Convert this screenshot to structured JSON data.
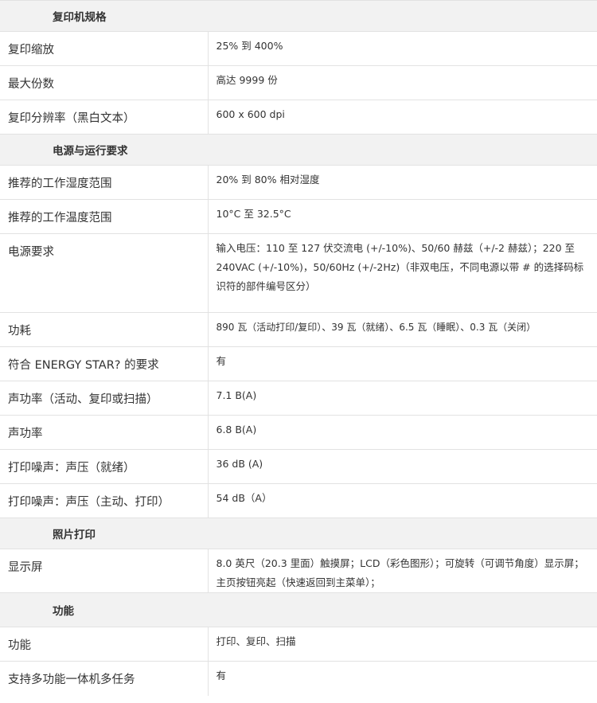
{
  "sections": [
    {
      "title": "复印机规格",
      "rows": [
        {
          "label": "复印缩放",
          "value": "25% 到 400%"
        },
        {
          "label": "最大份数",
          "value": "高达 9999 份"
        },
        {
          "label": "复印分辨率（黑白文本）",
          "value": "600 x 600 dpi"
        }
      ]
    },
    {
      "title": "电源与运行要求",
      "rows": [
        {
          "label": "推荐的工作湿度范围",
          "value": "20% 到 80% 相对湿度"
        },
        {
          "label": "推荐的工作温度范围",
          "value": "10°C 至 32.5°C"
        },
        {
          "label": "电源要求",
          "value": "输入电压：110 至 127 伏交流电 (+/-10%)、50/60 赫兹（+/-2 赫兹）；220 至 240VAC (+/-10%)，50/60Hz (+/-2Hz)（非双电压，不同电源以带 # 的选择码标识符的部件编号区分）"
        },
        {
          "label": "功耗",
          "value": "890 瓦（活动打印/复印）、39 瓦（就绪）、6.5 瓦（睡眠）、0.3 瓦（关闭）"
        },
        {
          "label": "符合 ENERGY STAR? 的要求",
          "value": "有"
        },
        {
          "label": "声功率（活动、复印或扫描）",
          "value": "7.1 B(A)"
        },
        {
          "label": "声功率",
          "value": "6.8 B(A)"
        },
        {
          "label": "打印噪声：声压（就绪）",
          "value": "36 dB (A)"
        },
        {
          "label": "打印噪声：声压（主动、打印）",
          "value": "54 dB（A）"
        }
      ]
    },
    {
      "title": "照片打印",
      "rows": [
        {
          "label": "显示屏",
          "value": "8.0 英尺（20.3 里面）触摸屏；LCD（彩色图形）；可旋转（可调节角度）显示屏；主页按钮亮起（快速返回到主菜单）；"
        }
      ]
    },
    {
      "title": "功能",
      "rows": [
        {
          "label": "功能",
          "value": "打印、复印、扫描"
        },
        {
          "label": "支持多功能一体机多任务",
          "value": "有"
        }
      ]
    }
  ]
}
